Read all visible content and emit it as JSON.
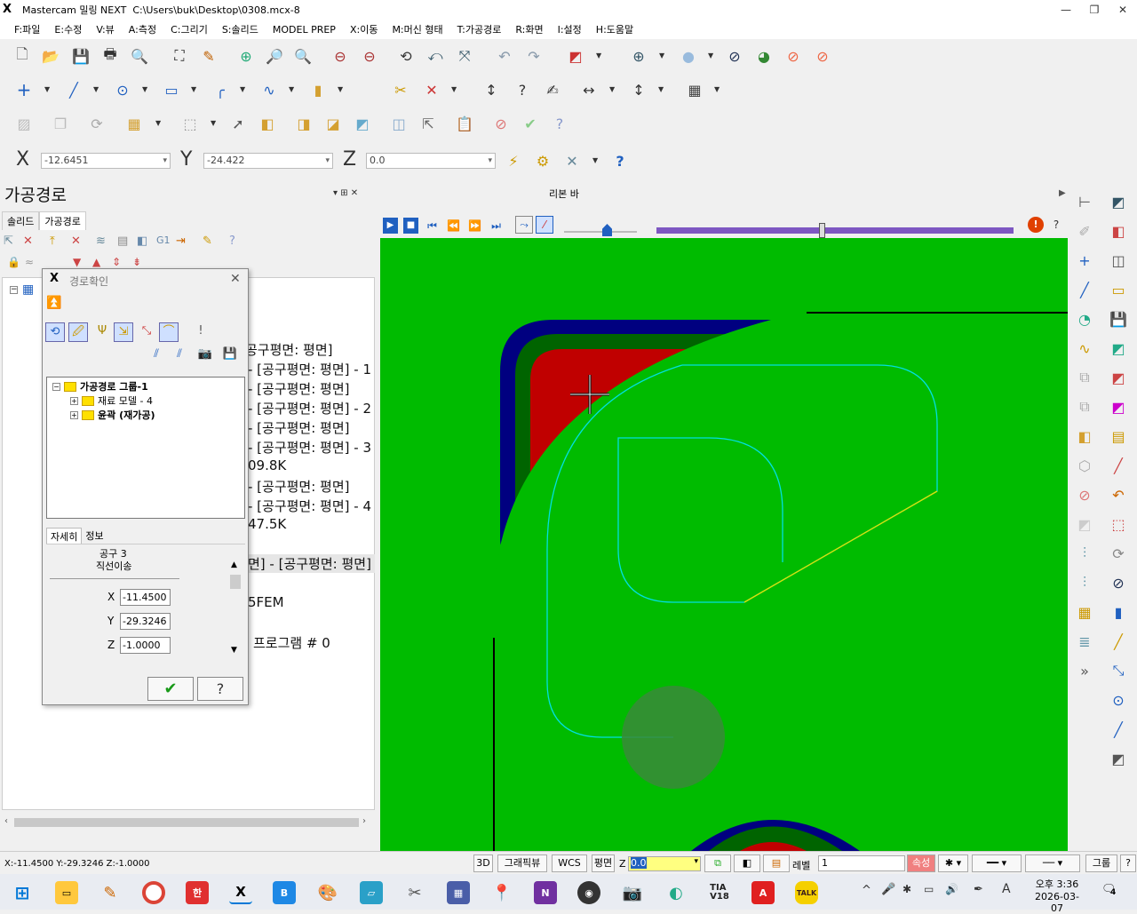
{
  "title": {
    "app": "Mastercam 밀링 NEXT",
    "path": "C:\\Users\\buk\\Desktop\\0308.mcx-8"
  },
  "menu": [
    "F:파일",
    "E:수정",
    "V:뷰",
    "A:측정",
    "C:그리기",
    "S:솔리드",
    "MODEL PREP",
    "X:이동",
    "M:머신 형태",
    "T:가공경로",
    "R:화면",
    "I:설정",
    "H:도움말"
  ],
  "coords": {
    "x_label": "X",
    "x_value": "-12.6451",
    "y_label": "Y",
    "y_value": "-24.422",
    "z_label": "Z",
    "z_value": "0.0"
  },
  "left_panel": {
    "title": "가공경로",
    "tabs": [
      "솔리드",
      "가공경로"
    ],
    "ops": [
      "공구평면: 평면]",
      "- [공구평면: 평면] - 1",
      "- [공구평면: 평면]",
      "- [공구평면: 평면] - 2",
      "- [공구평면: 평면]",
      "- [공구평면: 평면] - 3",
      "09.8K",
      "- [공구평면: 평면]",
      "- [공구평면: 평면] - 4",
      "47.5K",
      "면] - [공구평면: 평면]",
      "5FEM",
      "프로그램 # 0"
    ]
  },
  "dialog": {
    "title": "경로확인",
    "tree": {
      "root": "가공경로 그룹-1",
      "child1": "재료 모델 - 4",
      "child2": "윤곽 (재가공)"
    },
    "tabs": [
      "자세히",
      "정보"
    ],
    "tool": "공구 3",
    "move": "직선이송",
    "x_label": "X",
    "x": "-11.4500",
    "y_label": "Y",
    "y": "-29.3246",
    "z_label": "Z",
    "z": "-1.0000"
  },
  "ribbon_label": "리본 바",
  "status": {
    "coords": "X:-11.4500   Y:-29.3246   Z:-1.0000",
    "btn_3d": "3D",
    "graphic_view": "그래픽뷰",
    "wcs": "WCS",
    "plane": "평면",
    "z_label": "Z",
    "z_value": "0.0",
    "level_label": "레벨",
    "level_value": "1",
    "attr": "속성",
    "group": "그룹",
    "help": "?"
  },
  "taskbar": {
    "time": "오후 3:36",
    "date": "2026-03-07",
    "notif": "4",
    "ime": "A"
  },
  "colors": {
    "viewport": "#00bb00",
    "stock_red": "#c00000",
    "navy": "#000080",
    "dark_green": "#006400",
    "path": "#00e0e0"
  }
}
